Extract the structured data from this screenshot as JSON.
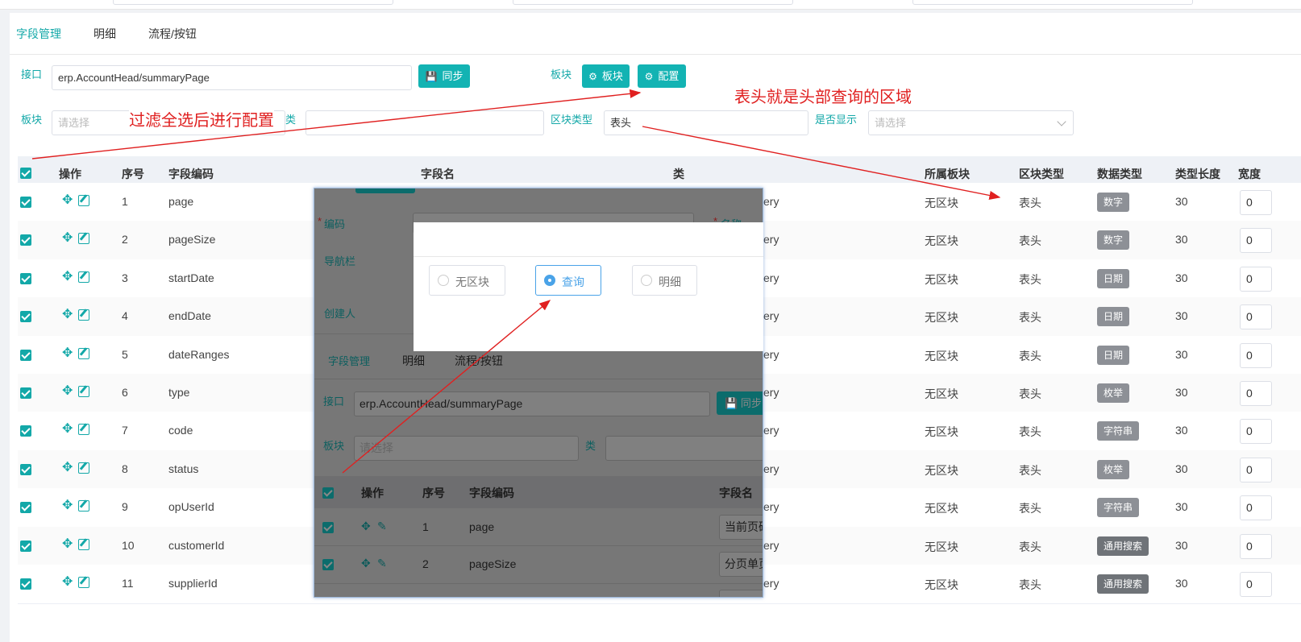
{
  "tabs": [
    "字段管理",
    "明细",
    "流程/按钮"
  ],
  "form": {
    "api_label": "接口",
    "api_value": "erp.AccountHead/summaryPage",
    "sync_label": "同步",
    "block_label": "板块",
    "block_btn": "板块",
    "config_btn": "配置",
    "block_filter_label": "板块",
    "block_filter_placeholder": "请选择",
    "class_label": "类",
    "area_type_label": "区块类型",
    "area_type_value": "表头",
    "show_label": "是否显示",
    "show_placeholder": "请选择"
  },
  "annotations": {
    "filter_note": "过滤全选后进行配置",
    "header_note": "表头就是头部查询的区域",
    "arrow_color": "#e02020"
  },
  "table": {
    "headers": [
      "操作",
      "序号",
      "字段编码",
      "字段名",
      "类",
      "所属板块",
      "区块类型",
      "数据类型",
      "类型长度",
      "宽度"
    ],
    "rows": [
      {
        "no": "1",
        "code": "page",
        "cls": "ery",
        "block": "无区块",
        "area": "表头",
        "dtype": "数字",
        "len": "30",
        "width": "0"
      },
      {
        "no": "2",
        "code": "pageSize",
        "cls": "ery",
        "block": "无区块",
        "area": "表头",
        "dtype": "数字",
        "len": "30",
        "width": "0"
      },
      {
        "no": "3",
        "code": "startDate",
        "cls": "ery",
        "block": "无区块",
        "area": "表头",
        "dtype": "日期",
        "len": "30",
        "width": "0"
      },
      {
        "no": "4",
        "code": "endDate",
        "cls": "ery",
        "block": "无区块",
        "area": "表头",
        "dtype": "日期",
        "len": "30",
        "width": "0"
      },
      {
        "no": "5",
        "code": "dateRanges",
        "cls": "ery",
        "block": "无区块",
        "area": "表头",
        "dtype": "日期",
        "len": "30",
        "width": "0"
      },
      {
        "no": "6",
        "code": "type",
        "cls": "ery",
        "block": "无区块",
        "area": "表头",
        "dtype": "枚举",
        "len": "30",
        "width": "0"
      },
      {
        "no": "7",
        "code": "code",
        "cls": "ery",
        "block": "无区块",
        "area": "表头",
        "dtype": "字符串",
        "len": "30",
        "width": "0"
      },
      {
        "no": "8",
        "code": "status",
        "cls": "ery",
        "block": "无区块",
        "area": "表头",
        "dtype": "枚举",
        "len": "30",
        "width": "0"
      },
      {
        "no": "9",
        "code": "opUserId",
        "cls": "ery",
        "block": "无区块",
        "area": "表头",
        "dtype": "字符串",
        "len": "30",
        "width": "0"
      },
      {
        "no": "10",
        "code": "customerId",
        "cls": "ery",
        "block": "无区块",
        "area": "表头",
        "dtype": "通用搜索",
        "len": "30",
        "width": "0"
      },
      {
        "no": "11",
        "code": "supplierId",
        "cls": "ery",
        "block": "无区块",
        "area": "表头",
        "dtype": "通用搜索",
        "len": "30",
        "width": "0"
      }
    ]
  },
  "overlay": {
    "code_label": "编码",
    "name_label": "名称",
    "nav_label": "导航栏",
    "creator_label": "创建人",
    "tabs": [
      "字段管理",
      "明细",
      "流程/按钮"
    ],
    "api_label": "接口",
    "api_value": "erp.AccountHead/summaryPage",
    "sync_label": "同步",
    "block_label": "板块",
    "block_placeholder": "请选择",
    "class_label": "类",
    "headers": [
      "操作",
      "序号",
      "字段编码",
      "字段名"
    ],
    "rows": [
      {
        "no": "1",
        "code": "page",
        "name": "当前页码"
      },
      {
        "no": "2",
        "code": "pageSize",
        "name": "分页单页"
      }
    ]
  },
  "dialog": {
    "options": [
      "无区块",
      "查询",
      "明细"
    ],
    "selected": "查询"
  }
}
